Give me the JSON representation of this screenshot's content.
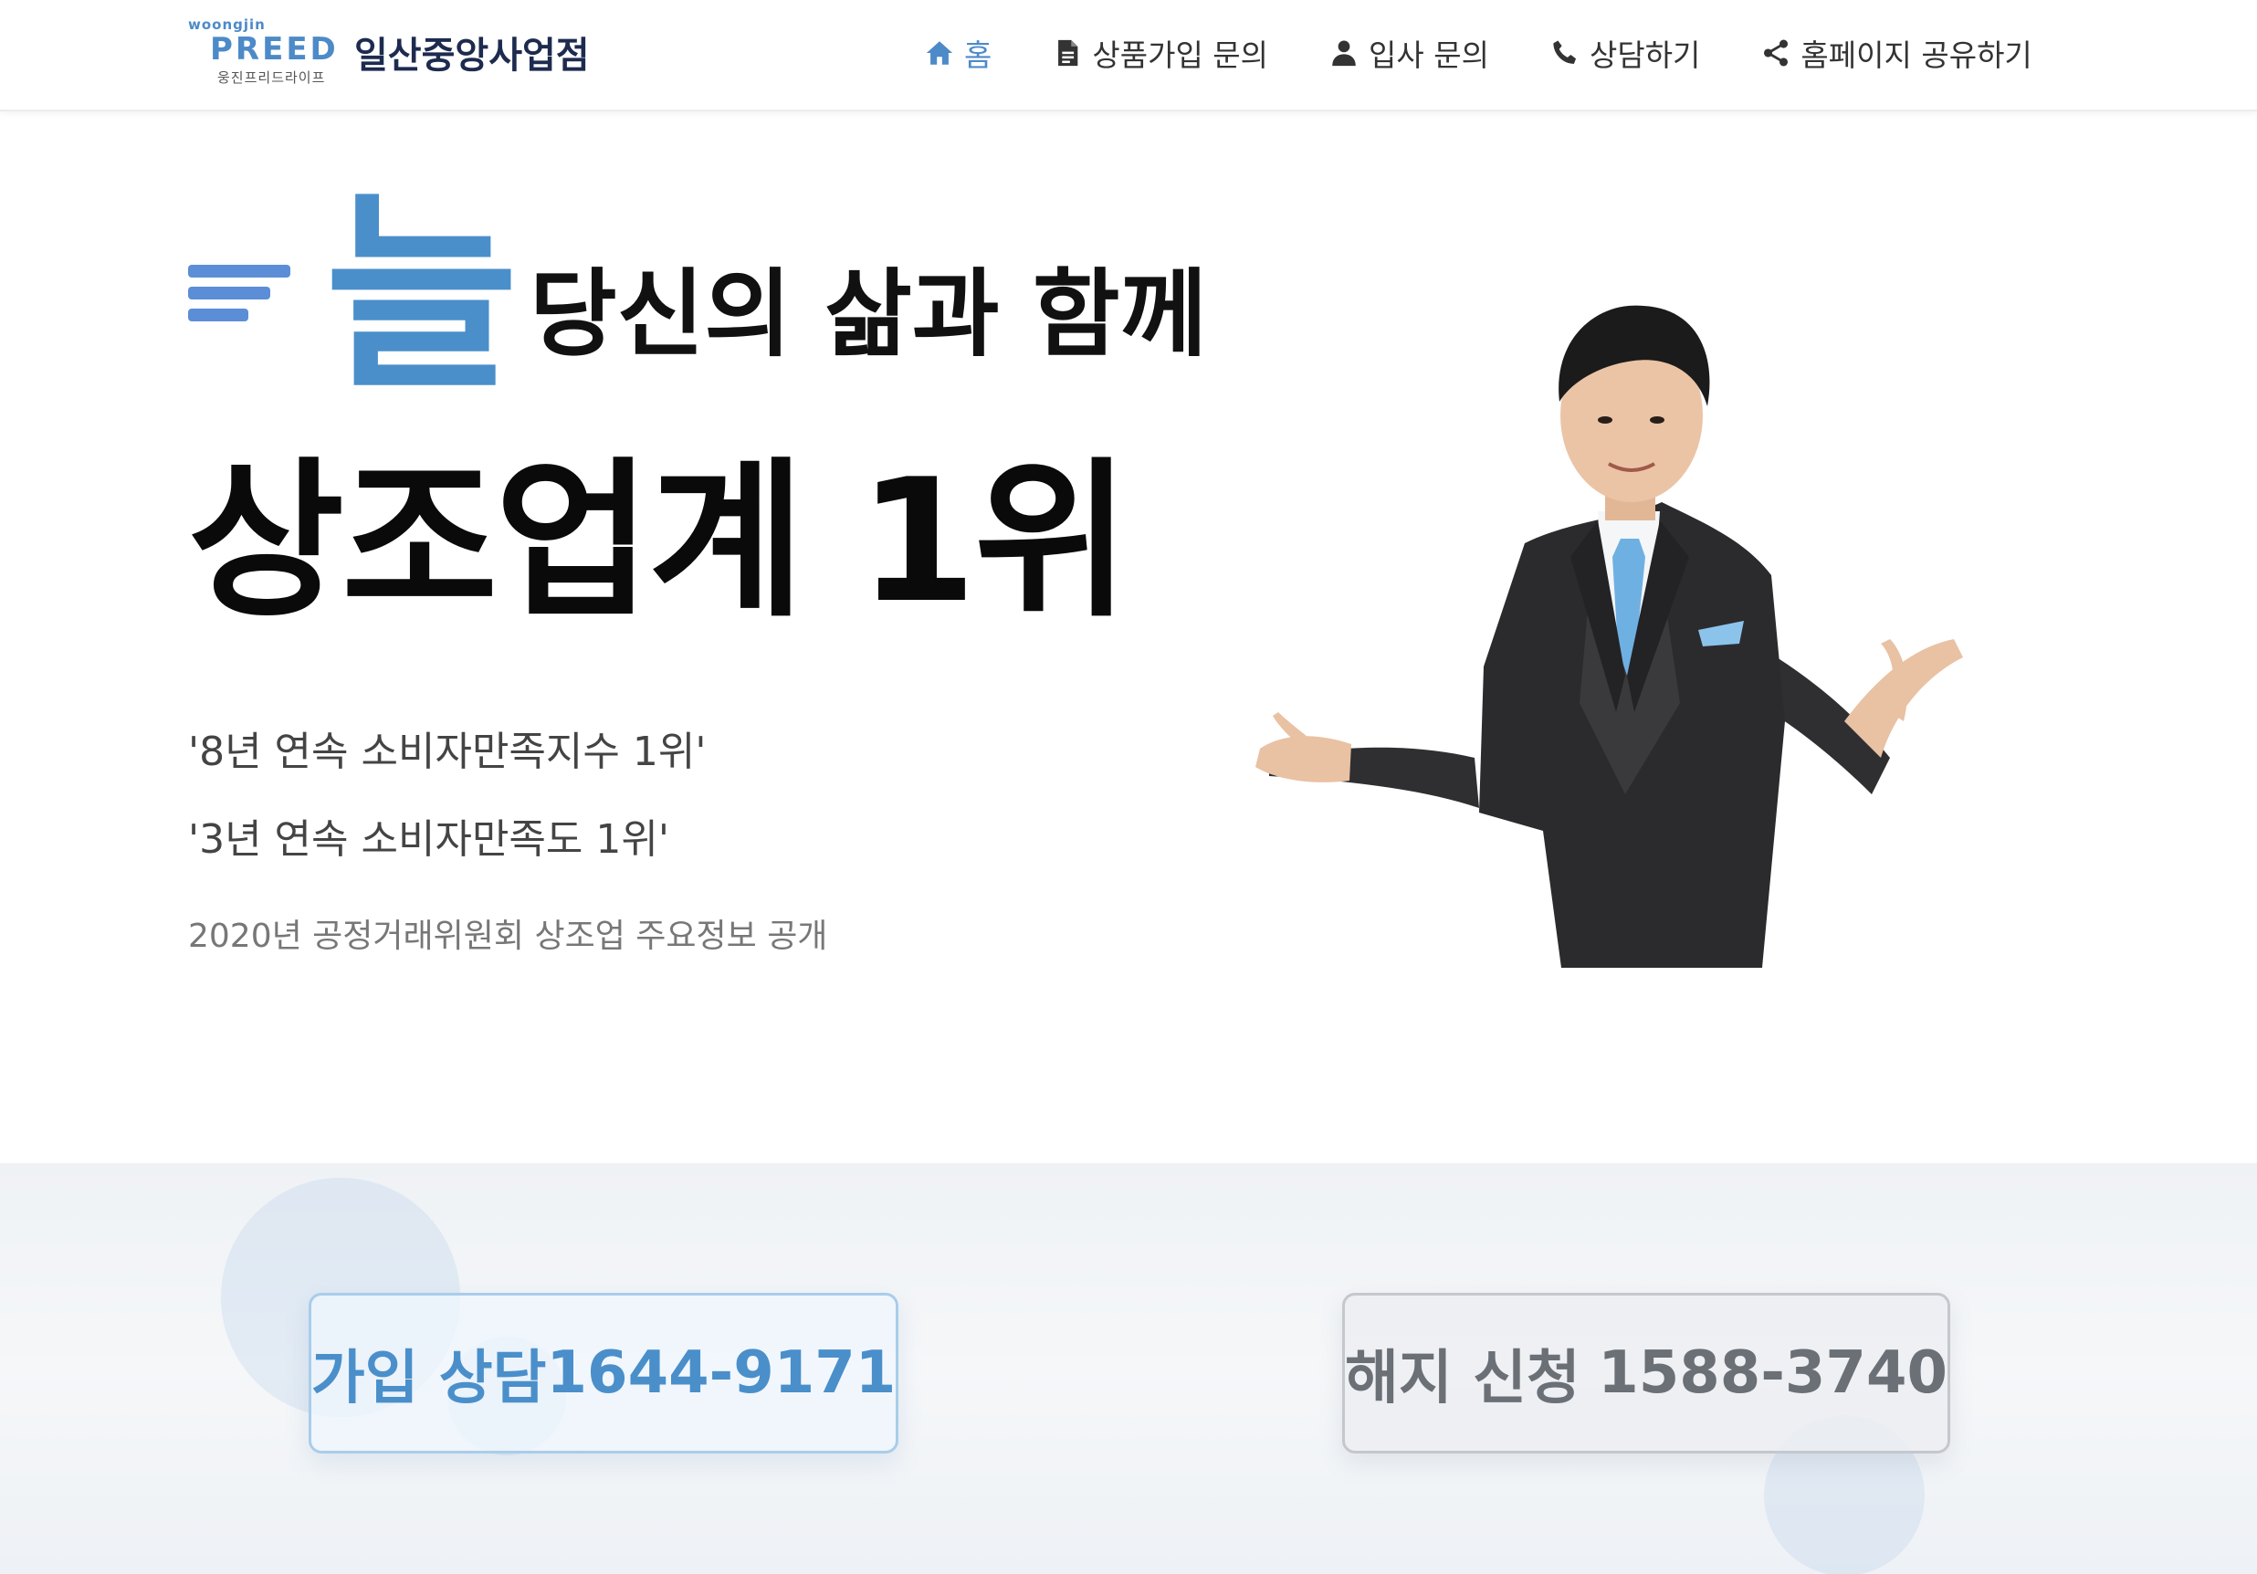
{
  "navbar": {
    "logo": {
      "small": "woongjin",
      "main": "PREED",
      "sub": "웅진프리드라이프"
    },
    "branch_name": "일산중앙사업점",
    "items": [
      {
        "label": "홈",
        "icon": "home-icon",
        "active": true
      },
      {
        "label": "상품가입 문의",
        "icon": "document-icon",
        "active": false
      },
      {
        "label": "입사 문의",
        "icon": "person-icon",
        "active": false
      },
      {
        "label": "상담하기",
        "icon": "phone-icon",
        "active": false
      },
      {
        "label": "홈페이지 공유하기",
        "icon": "share-icon",
        "active": false
      }
    ]
  },
  "hero": {
    "big_glyph": "늘",
    "tagline": "당신의 삶과 함께",
    "headline": "상조업계 1위",
    "sub_lines": [
      "'8년 연속 소비자만족지수 1위'",
      "'3년 연속 소비자만족도 1위'"
    ],
    "source_note": "2020년 공정거래위원회 상조업 주요정보 공개"
  },
  "cta": {
    "join": {
      "label": "가입 상담",
      "phone": "1644-9171"
    },
    "cancel": {
      "label": "해지 신청",
      "phone": "1588-3740"
    }
  },
  "colors": {
    "accent": "#4a8fca",
    "active_nav": "#4d8ac8",
    "suit": "#2d2d30",
    "tie": "#6fb0e3"
  }
}
